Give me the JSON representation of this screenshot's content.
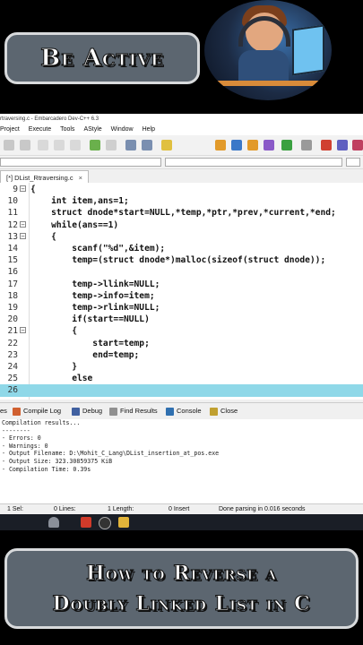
{
  "top_banner": {
    "text": "Be Active"
  },
  "bottom_banner": {
    "line1": "How to Reverse a",
    "line2": "Doubly Linked List in C"
  },
  "ide": {
    "title": "rtraversing.c - Embarcadero Dev-C++ 6.3",
    "menu": [
      "Project",
      "Execute",
      "Tools",
      "AStyle",
      "Window",
      "Help"
    ],
    "tab": {
      "label": "[*] DList_Rtraversing.c",
      "close": "×"
    },
    "code_lines": [
      {
        "n": "9",
        "code": "{"
      },
      {
        "n": "10",
        "code": "    int item,ans=1;"
      },
      {
        "n": "11",
        "code": "    struct dnode*start=NULL,*temp,*ptr,*prev,*current,*end;"
      },
      {
        "n": "12",
        "code": "    while(ans==1)"
      },
      {
        "n": "13",
        "code": "    {"
      },
      {
        "n": "14",
        "code": "        scanf(\"%d\",&item);"
      },
      {
        "n": "15",
        "code": "        temp=(struct dnode*)malloc(sizeof(struct dnode));"
      },
      {
        "n": "16",
        "code": ""
      },
      {
        "n": "17",
        "code": "        temp->llink=NULL;"
      },
      {
        "n": "18",
        "code": "        temp->info=item;"
      },
      {
        "n": "19",
        "code": "        temp->rlink=NULL;"
      },
      {
        "n": "20",
        "code": "        if(start==NULL)"
      },
      {
        "n": "21",
        "code": "        {"
      },
      {
        "n": "22",
        "code": "            start=temp;"
      },
      {
        "n": "23",
        "code": "            end=temp;"
      },
      {
        "n": "24",
        "code": "        }"
      },
      {
        "n": "25",
        "code": "        else"
      },
      {
        "n": "26",
        "code": ""
      }
    ],
    "bottom_tabs": {
      "t0": "es",
      "compile_log": "Compile Log",
      "debug": "Debug",
      "find_results": "Find Results",
      "console": "Console",
      "close": "Close"
    },
    "log_lines": [
      "Compilation results...",
      "--------",
      "- Errors: 0",
      "- Warnings: 0",
      "- Output Filename: D:\\Mohit_C_Lang\\DList_insertion_at_pos.exe",
      "- Output Size: 323.30859375 KiB",
      "- Compilation Time: 0.39s"
    ],
    "status": {
      "sel": "1  Sel:",
      "lines": "0  Lines:",
      "length": "1  Length:",
      "insert": "0  Insert",
      "parse": "Done parsing in 0.016 seconds"
    }
  }
}
